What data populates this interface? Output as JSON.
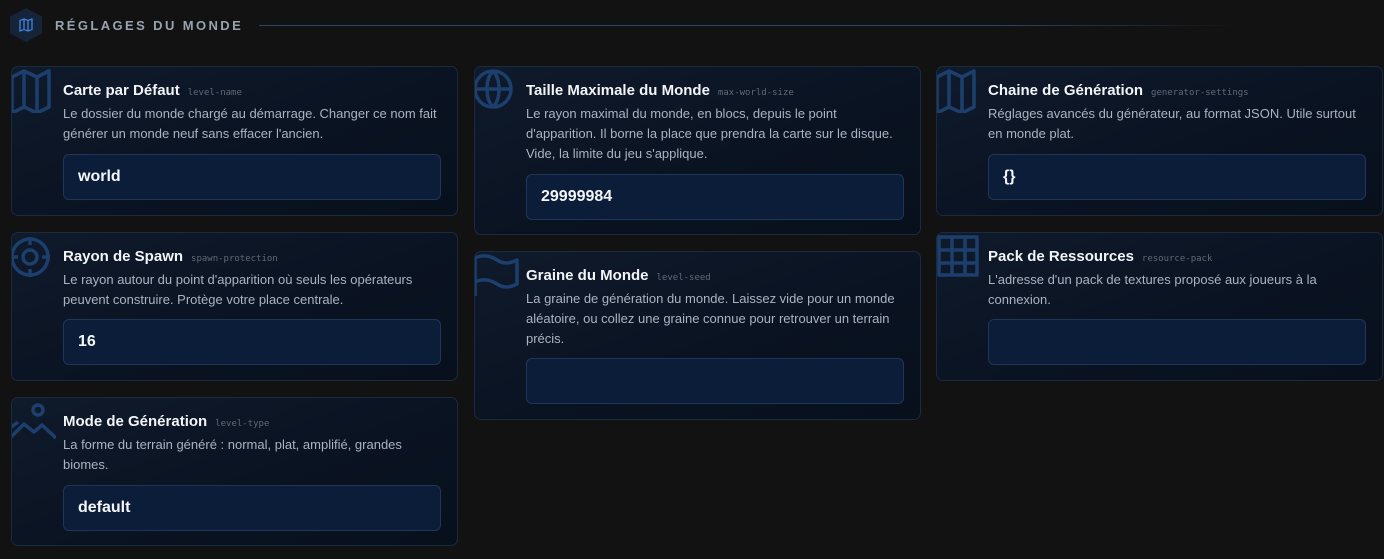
{
  "section": {
    "title": "RÉGLAGES DU MONDE",
    "icon": "map-icon"
  },
  "cards": {
    "level_name": {
      "title": "Carte par Défaut",
      "key": "level-name",
      "description": "Le dossier du monde chargé au démarrage. Changer ce nom fait générer un monde neuf sans effacer l'ancien.",
      "value": "world",
      "icon": "map-icon"
    },
    "spawn_protection": {
      "title": "Rayon de Spawn",
      "key": "spawn-protection",
      "description": "Le rayon autour du point d'apparition où seuls les opérateurs peuvent construire. Protège votre place centrale.",
      "value": "16",
      "icon": "target-icon"
    },
    "level_type": {
      "title": "Mode de Génération",
      "key": "level-type",
      "description": "La forme du terrain généré : normal, plat, amplifié, grandes biomes.",
      "value": "default",
      "icon": "landscape-icon"
    },
    "max_world_size": {
      "title": "Taille Maximale du Monde",
      "key": "max-world-size",
      "description": "Le rayon maximal du monde, en blocs, depuis le point d'apparition. Il borne la place que prendra la carte sur le disque. Vide, la limite du jeu s'applique.",
      "value": "29999984",
      "icon": "globe-icon"
    },
    "level_seed": {
      "title": "Graine du Monde",
      "key": "level-seed",
      "description": "La graine de génération du monde. Laissez vide pour un monde aléatoire, ou collez une graine connue pour retrouver un terrain précis.",
      "value": "",
      "icon": "flag-icon"
    },
    "generator_settings": {
      "title": "Chaine de Génération",
      "key": "generator-settings",
      "description": "Réglages avancés du générateur, au format JSON. Utile surtout en monde plat.",
      "value": "{}",
      "icon": "map-icon"
    },
    "resource_pack": {
      "title": "Pack de Ressources",
      "key": "resource-pack",
      "description": "L'adresse d'un pack de textures proposé aux joueurs à la connexion.",
      "value": "",
      "icon": "grid-icon"
    }
  }
}
